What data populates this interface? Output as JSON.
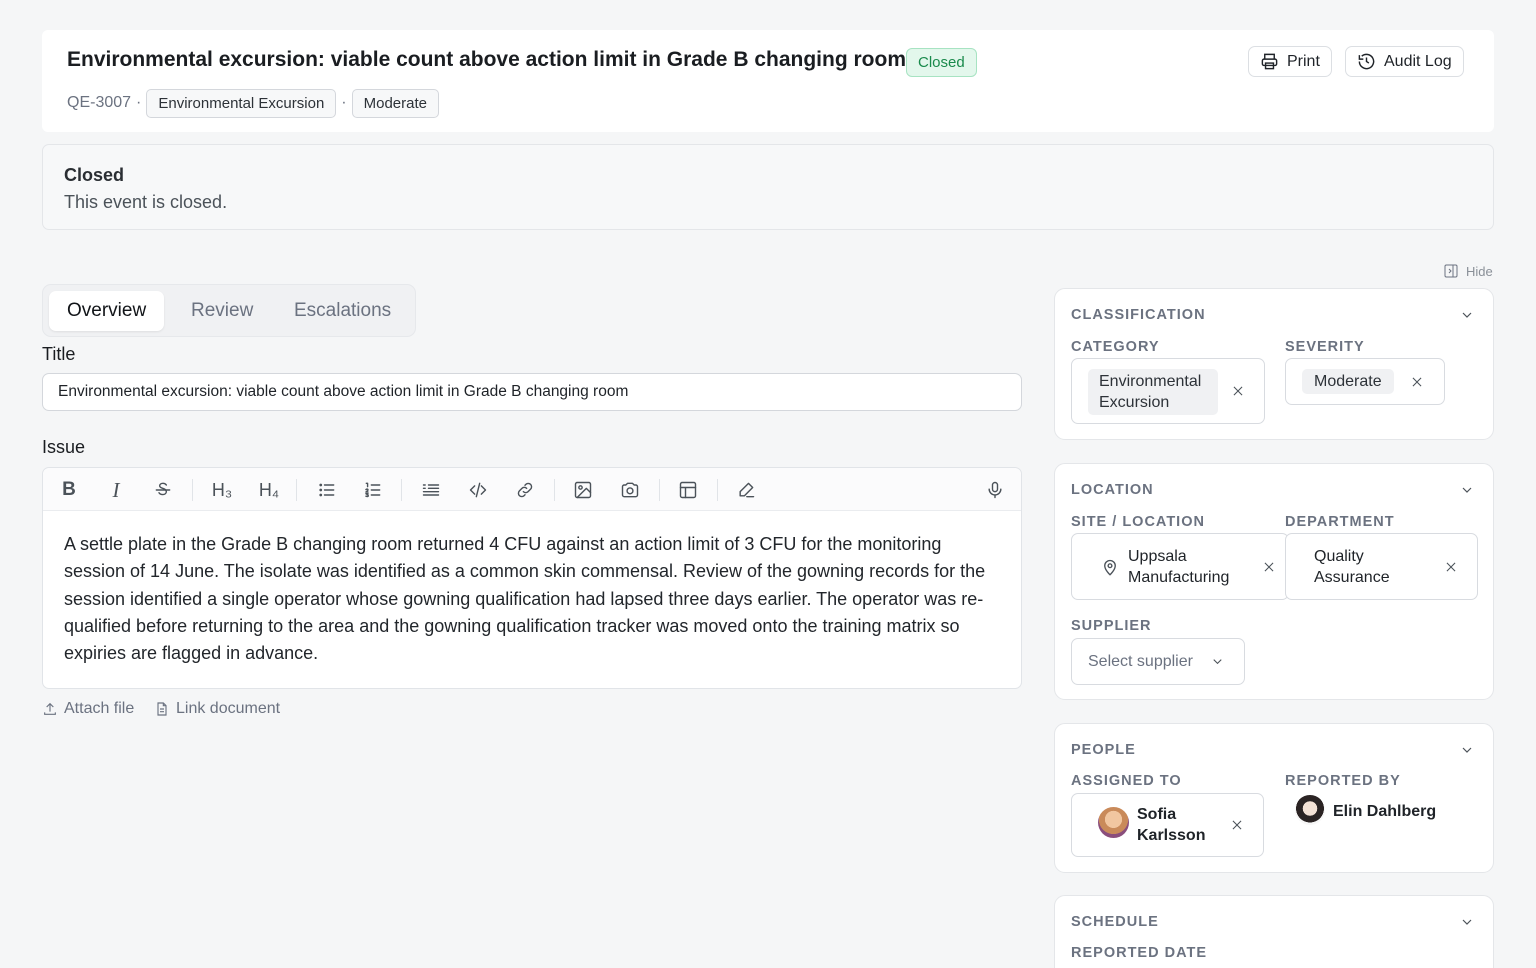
{
  "header": {
    "title": "Environmental excursion: viable count above action limit in Grade B changing room",
    "status": "Closed",
    "id": "QE-3007",
    "category_tag": "Environmental Excursion",
    "severity_tag": "Moderate",
    "sep": "·",
    "print_label": "Print",
    "audit_label": "Audit Log"
  },
  "banner": {
    "title": "Closed",
    "text": "This event is closed."
  },
  "tabs": [
    "Overview",
    "Review",
    "Escalations"
  ],
  "form": {
    "title_label": "Title",
    "title_value": "Environmental excursion: viable count above action limit in Grade B changing room",
    "issue_label": "Issue",
    "issue_text": "A settle plate in the Grade B changing room returned 4 CFU against an action limit of 3 CFU for the monitoring session of 14 June. The isolate was identified as a common skin commensal. Review of the gowning records for the session identified a single operator whose gowning qualification had lapsed three days earlier. The operator was re-qualified before returning to the area and the gowning qualification tracker was moved onto the training matrix so expiries are flagged in advance.",
    "attach_label": "Attach file",
    "link_label": "Link document"
  },
  "toolbar": {
    "bold": "B",
    "italic": "I",
    "h3": "H₃",
    "h4": "H₄"
  },
  "sidebar": {
    "hide_label": "Hide",
    "classification": {
      "title": "CLASSIFICATION",
      "category_label": "CATEGORY",
      "category_value": "Environmental Excursion",
      "severity_label": "SEVERITY",
      "severity_value": "Moderate"
    },
    "location": {
      "title": "LOCATION",
      "site_label": "SITE / LOCATION",
      "site_value": "Uppsala Manufacturing",
      "department_label": "DEPARTMENT",
      "department_value": "Quality Assurance",
      "supplier_label": "SUPPLIER",
      "supplier_placeholder": "Select supplier"
    },
    "people": {
      "title": "PEOPLE",
      "assigned_label": "ASSIGNED TO",
      "assigned_value": "Sofia Karlsson",
      "reported_label": "REPORTED BY",
      "reported_value": "Elin Dahlberg"
    },
    "schedule": {
      "title": "SCHEDULE",
      "reported_date_label": "REPORTED DATE"
    }
  },
  "colors": {
    "accent_closed": "#1a8a4c",
    "background": "#f5f6f7"
  }
}
